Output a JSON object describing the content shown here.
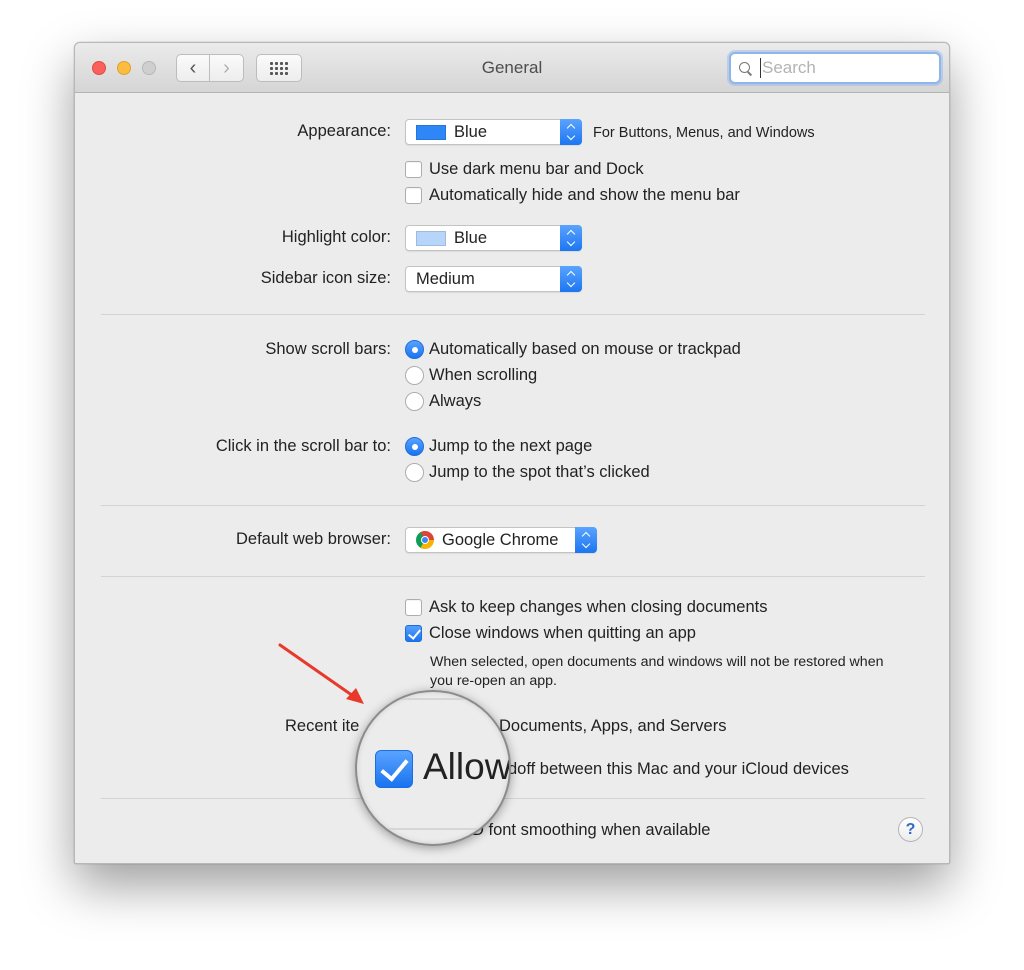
{
  "window": {
    "title": "General",
    "search_placeholder": "Search"
  },
  "appearance": {
    "label": "Appearance:",
    "value": "Blue",
    "swatch_color": "#2e86f7",
    "note": "For Buttons, Menus, and Windows",
    "dark_menu_label": "Use dark menu bar and Dock",
    "auto_hide_label": "Automatically hide and show the menu bar"
  },
  "highlight": {
    "label": "Highlight color:",
    "value": "Blue",
    "swatch_color": "#b7d4fb"
  },
  "sidebar_size": {
    "label": "Sidebar icon size:",
    "value": "Medium"
  },
  "scroll_bars": {
    "label": "Show scroll bars:",
    "options": [
      "Automatically based on mouse or trackpad",
      "When scrolling",
      "Always"
    ],
    "selected": "Automatically based on mouse or trackpad"
  },
  "scroll_click": {
    "label": "Click in the scroll bar to:",
    "options": [
      "Jump to the next page",
      "Jump to the spot that’s clicked"
    ],
    "selected": "Jump to the next page"
  },
  "browser": {
    "label": "Default web browser:",
    "value": "Google Chrome"
  },
  "documents": {
    "ask_keep_label": "Ask to keep changes when closing documents",
    "close_windows_label": "Close windows when quitting an app",
    "help_text": "When selected, open documents and windows will not be restored when you re-open an app."
  },
  "recent": {
    "label_visible": "Recent ite",
    "trailing_visible": "Documents, Apps, and Servers"
  },
  "handoff": {
    "trailing_visible": "doff between this Mac and your iCloud devices"
  },
  "font_smoothing": {
    "trailing_visible": "D font smoothing when available"
  },
  "magnifier": {
    "text": "Allow"
  },
  "help_button": {
    "label": "?"
  },
  "colors": {
    "accent": "#1a74ef",
    "annotation_arrow": "#e8392b"
  }
}
